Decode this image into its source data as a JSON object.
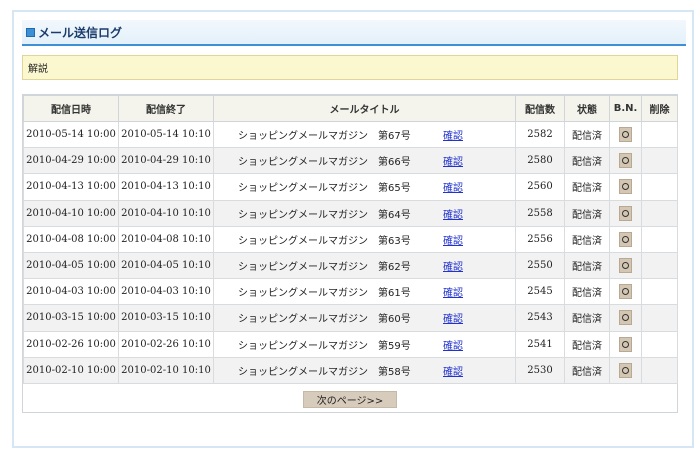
{
  "page": {
    "title": "メール送信ログ",
    "explain": "解説",
    "next_page": "次のページ>>"
  },
  "table": {
    "headers": [
      "配信日時",
      "配信終了",
      "メールタイトル",
      "配信数",
      "状態",
      "B.N.",
      "削除"
    ],
    "confirm_label": "確認",
    "rows": [
      {
        "start": "2010-05-14 10:00",
        "end": "2010-05-14 10:10",
        "title": "ショッピングメールマガジン　第67号",
        "count": "2582",
        "status": "配信済"
      },
      {
        "start": "2010-04-29 10:00",
        "end": "2010-04-29 10:10",
        "title": "ショッピングメールマガジン　第66号",
        "count": "2580",
        "status": "配信済"
      },
      {
        "start": "2010-04-13 10:00",
        "end": "2010-04-13 10:10",
        "title": "ショッピングメールマガジン　第65号",
        "count": "2560",
        "status": "配信済"
      },
      {
        "start": "2010-04-10 10:00",
        "end": "2010-04-10 10:10",
        "title": "ショッピングメールマガジン　第64号",
        "count": "2558",
        "status": "配信済"
      },
      {
        "start": "2010-04-08 10:00",
        "end": "2010-04-08 10:10",
        "title": "ショッピングメールマガジン　第63号",
        "count": "2556",
        "status": "配信済"
      },
      {
        "start": "2010-04-05 10:00",
        "end": "2010-04-05 10:10",
        "title": "ショッピングメールマガジン　第62号",
        "count": "2550",
        "status": "配信済"
      },
      {
        "start": "2010-04-03 10:00",
        "end": "2010-04-03 10:10",
        "title": "ショッピングメールマガジン　第61号",
        "count": "2545",
        "status": "配信済"
      },
      {
        "start": "2010-03-15 10:00",
        "end": "2010-03-15 10:10",
        "title": "ショッピングメールマガジン　第60号",
        "count": "2543",
        "status": "配信済"
      },
      {
        "start": "2010-02-26 10:00",
        "end": "2010-02-26 10:10",
        "title": "ショッピングメールマガジン　第59号",
        "count": "2541",
        "status": "配信済"
      },
      {
        "start": "2010-02-10 10:00",
        "end": "2010-02-10 10:10",
        "title": "ショッピングメールマガジン　第58号",
        "count": "2530",
        "status": "配信済"
      }
    ]
  },
  "icons": {
    "bn": "circle-icon",
    "title": "square-icon"
  },
  "colors": {
    "accent": "#3d8fd6",
    "link": "#2233cc",
    "explain_bg": "#fbf7cf"
  }
}
